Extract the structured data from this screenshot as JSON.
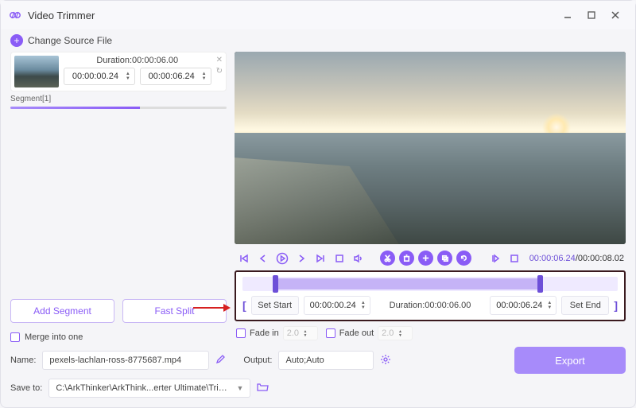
{
  "app": {
    "title": "Video Trimmer"
  },
  "source": {
    "change_label": "Change Source File"
  },
  "segment": {
    "duration_label": "Duration:00:00:06.00",
    "start": "00:00:00.24",
    "end": "00:00:06.24",
    "label": "Segment[1]"
  },
  "buttons": {
    "add_segment": "Add Segment",
    "fast_split": "Fast Split",
    "merge": "Merge into one",
    "set_start": "Set Start",
    "set_end": "Set End",
    "export": "Export"
  },
  "playback": {
    "current": "00:00:06.24",
    "total": "00:00:08.02"
  },
  "trim": {
    "start": "00:00:00.24",
    "duration_label": "Duration:00:00:06.00",
    "end": "00:00:06.24"
  },
  "fade": {
    "in_label": "Fade in",
    "out_label": "Fade out",
    "in_val": "2.0",
    "out_val": "2.0"
  },
  "output": {
    "name_label": "Name:",
    "name_value": "pexels-lachlan-ross-8775687.mp4",
    "output_label": "Output:",
    "output_value": "Auto;Auto",
    "save_label": "Save to:",
    "save_value": "C:\\ArkThinker\\ArkThink...erter Ultimate\\Trimmer"
  }
}
